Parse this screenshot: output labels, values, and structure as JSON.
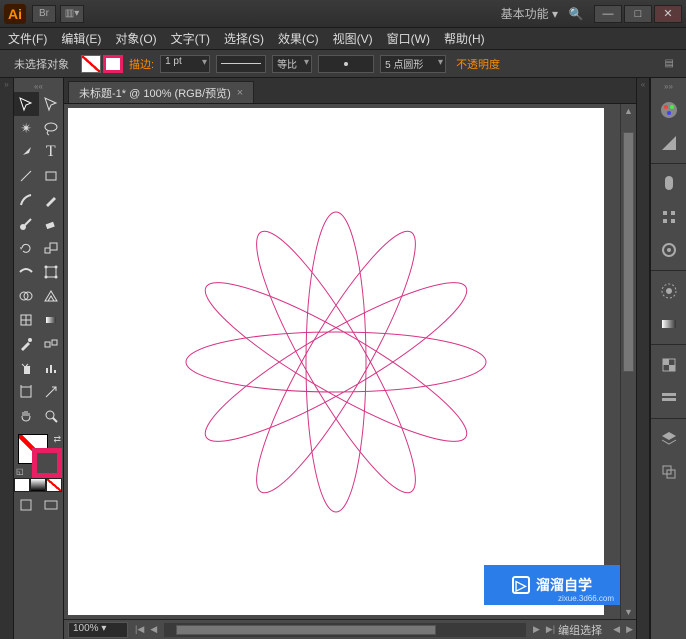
{
  "titlebar": {
    "logo": "Ai",
    "bridge_label": "Br",
    "arrange_label": "▥▾",
    "workspace": "基本功能",
    "search_glyph": "🔍"
  },
  "window_controls": {
    "min": "—",
    "max": "□",
    "close": "✕"
  },
  "menu": {
    "file": "文件(F)",
    "edit": "编辑(E)",
    "object": "对象(O)",
    "type": "文字(T)",
    "select": "选择(S)",
    "effect": "效果(C)",
    "view": "视图(V)",
    "window": "窗口(W)",
    "help": "帮助(H)"
  },
  "control": {
    "selection": "未选择对象",
    "stroke_label": "描边:",
    "stroke_weight": "1 pt",
    "profile_label": "等比",
    "brush_label": "5 点圆形",
    "opacity_label": "不透明度"
  },
  "doc": {
    "tab": "未标题-1* @ 100% (RGB/预览)",
    "close_glyph": "×"
  },
  "status": {
    "zoom": "100%",
    "mode": "编组选择",
    "nav_first": "|◀",
    "nav_prev": "◀",
    "nav_next": "▶",
    "nav_last": "▶|"
  },
  "watermark": {
    "text": "溜溜自学",
    "url": "zixue.3d66.com",
    "play": "▷"
  },
  "tools": {
    "row1a": "sel",
    "row1b": "direct",
    "row2a": "wand",
    "row2b": "lasso",
    "row3a": "pen",
    "row3b": "type",
    "row4a": "line",
    "row4b": "rect",
    "row5a": "brush",
    "row5b": "pencil",
    "row6a": "blob",
    "row6b": "eraser",
    "row7a": "rotate",
    "row7b": "scale",
    "row8a": "width",
    "row8b": "freetf",
    "row9a": "shapebld",
    "row9b": "persp",
    "row10a": "mesh",
    "row10b": "gradient",
    "row11a": "eyedrop",
    "row11b": "blend",
    "row12a": "symbol",
    "row12b": "graph",
    "row13a": "artboard",
    "row13b": "slice",
    "row14a": "hand",
    "row14b": "zoom"
  }
}
